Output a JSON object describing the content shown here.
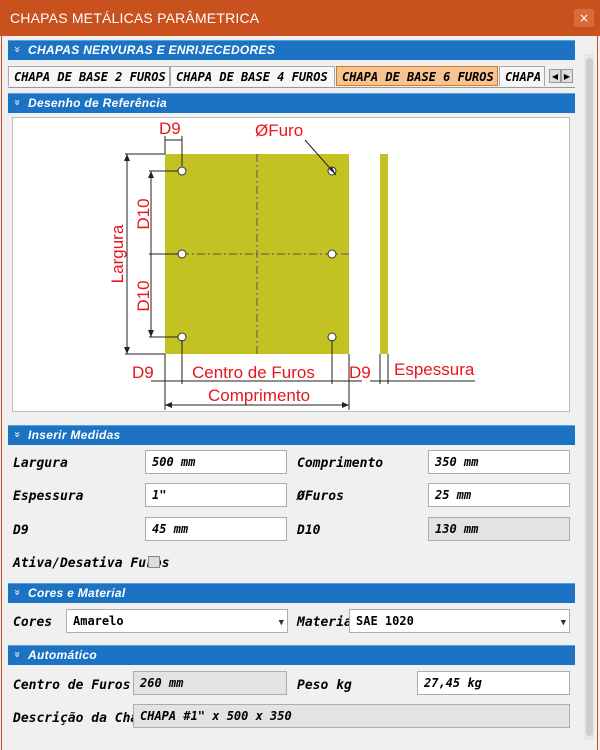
{
  "window": {
    "title": "CHAPAS METÁLICAS PARÂMETRICA",
    "close": "×"
  },
  "sections": {
    "main": "CHAPAS NERVURAS E ENRIJECEDORES",
    "drawing": "Desenho de Referência",
    "measures": "Inserir Medidas",
    "colors": "Cores e Material",
    "auto": "Automático",
    "chevron": "»"
  },
  "tabs": [
    {
      "label": "CHAPA DE BASE 2 FUROS",
      "active": false
    },
    {
      "label": "CHAPA DE BASE 4 FUROS",
      "active": false
    },
    {
      "label": "CHAPA DE BASE 6 FUROS",
      "active": true
    },
    {
      "label": "CHAPA",
      "active": false
    }
  ],
  "tab_scroll": {
    "left": "◀",
    "right": "▶"
  },
  "drawing": {
    "plate_color": "#c2c322",
    "dim_color": "#e8141e",
    "labels": {
      "d9_top": "D9",
      "hole": "ØFuro",
      "largura": "Largura",
      "d10_a": "D10",
      "d10_b": "D10",
      "d9_bottom_left": "D9",
      "centro": "Centro de Furos",
      "d9_bottom_right": "D9",
      "espessura": "Espessura",
      "comprimento": "Comprimento"
    }
  },
  "measures": {
    "largura_label": "Largura",
    "largura_value": "500 mm",
    "comprimento_label": "Comprimento",
    "comprimento_value": "350 mm",
    "espessura_label": "Espessura",
    "espessura_value": "1\"",
    "furos_label": "ØFuros",
    "furos_value": "25 mm",
    "d9_label": "D9",
    "d9_value": "45 mm",
    "d10_label": "D10",
    "d10_value": "130 mm",
    "toggle_label": "Ativa/Desativa Furos"
  },
  "colors": {
    "cores_label": "Cores",
    "cores_value": "Amarelo",
    "material_label": "Material",
    "material_value": "SAE 1020",
    "arrow": "▼"
  },
  "auto": {
    "centro_label": "Centro de Furos",
    "centro_value": "260 mm",
    "peso_label": "Peso kg",
    "peso_value": "27,45 kg",
    "descricao_label": "Descrição da Chapa",
    "descricao_value": "CHAPA #1\" x 500 x 350"
  }
}
